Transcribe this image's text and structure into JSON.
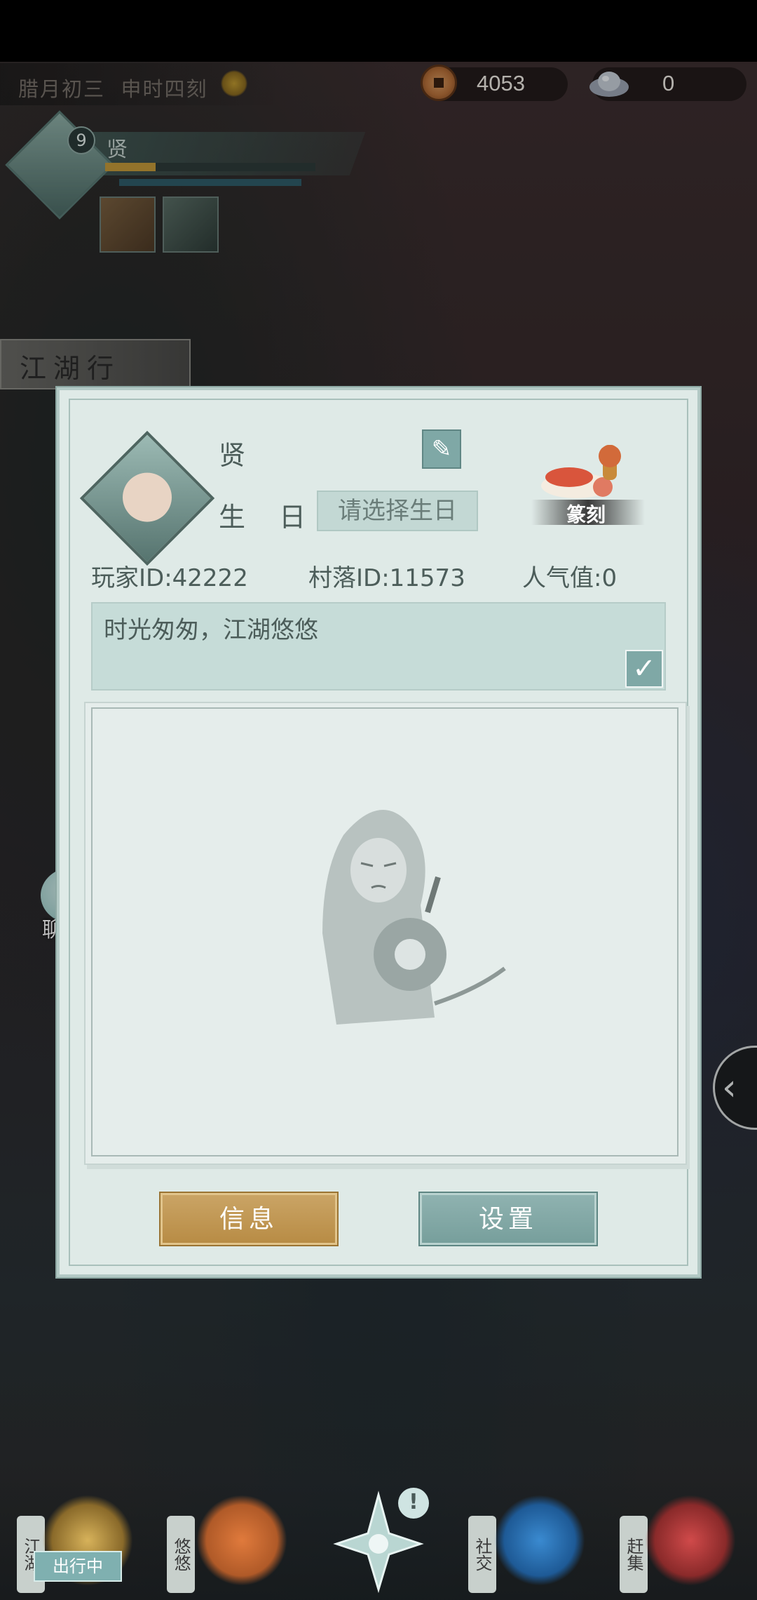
{
  "hud": {
    "date": "腊月初三",
    "time": "申时四刻",
    "coins": "4053",
    "silver": "0"
  },
  "player": {
    "level": "9",
    "name": "贤"
  },
  "map_banner": "江湖行",
  "side": {
    "chat_label": "聊天"
  },
  "profile": {
    "name": "贤",
    "birthday_label": "生 日:",
    "birthday_placeholder": "请选择生日",
    "seal_label": "篆刻",
    "player_id": "玩家ID:42222",
    "village_id": "村落ID:11573",
    "popularity": "人气值:0",
    "signature": "时光匆匆，江湖悠悠",
    "info_button": "信息",
    "settings_button": "设置"
  },
  "bottom_nav": {
    "jianghu": "江湖",
    "travel_status": "出行中",
    "youyou": "悠悠",
    "alert": "!",
    "social": "社交",
    "market": "赶集"
  },
  "colors": {
    "accent_gold": "#c59a3a",
    "panel_bg": "#dfeae7",
    "teal": "#7fa8a6"
  }
}
